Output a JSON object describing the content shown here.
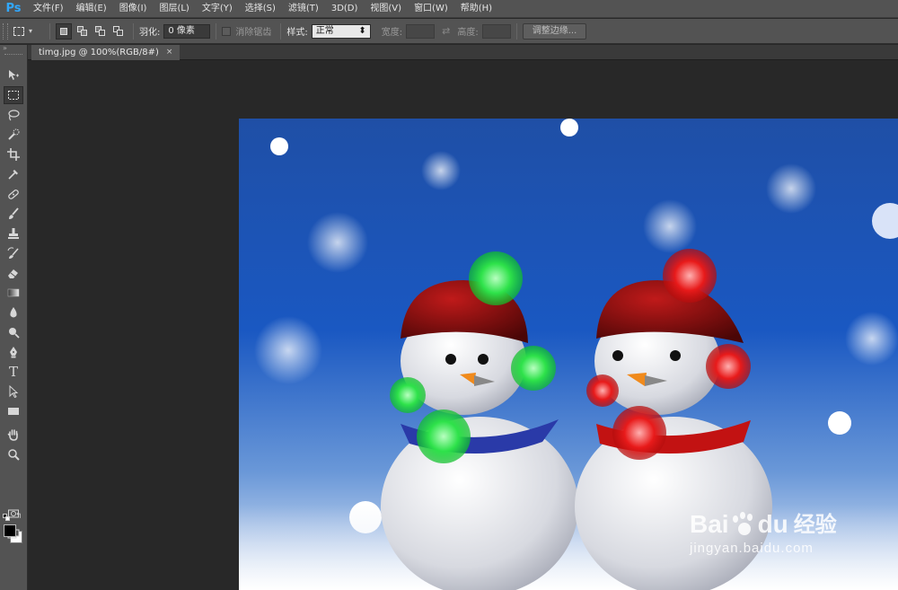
{
  "app": {
    "logo": "Ps"
  },
  "menu": [
    "文件(F)",
    "编辑(E)",
    "图像(I)",
    "图层(L)",
    "文字(Y)",
    "选择(S)",
    "滤镜(T)",
    "3D(D)",
    "视图(V)",
    "窗口(W)",
    "帮助(H)"
  ],
  "options": {
    "feather_label": "羽化:",
    "feather_value": "0 像素",
    "antialias_label": "消除锯齿",
    "style_label": "样式:",
    "style_value": "正常",
    "width_label": "宽度:",
    "height_label": "高度:",
    "refine_edge_label": "调整边缘..."
  },
  "document": {
    "tab_title": "timg.jpg @ 100%(RGB/8#)",
    "close_glyph": "×"
  },
  "toolbar": {
    "active_tool": "rectangular-marquee",
    "tools": [
      "move",
      "rectangular-marquee",
      "lasso",
      "quick-selection",
      "crop",
      "eyedropper",
      "spot-healing-brush",
      "brush",
      "clone-stamp",
      "history-brush",
      "eraser",
      "gradient",
      "blur",
      "dodge",
      "pen",
      "horizontal-type",
      "path-selection",
      "rectangle",
      "hand",
      "zoom"
    ],
    "foreground_color": "#000000",
    "background_color": "#ffffff"
  },
  "watermark": {
    "brand": "Bai",
    "brand_suffix": "du",
    "cn": "经验",
    "url": "jingyan.baidu.com"
  }
}
